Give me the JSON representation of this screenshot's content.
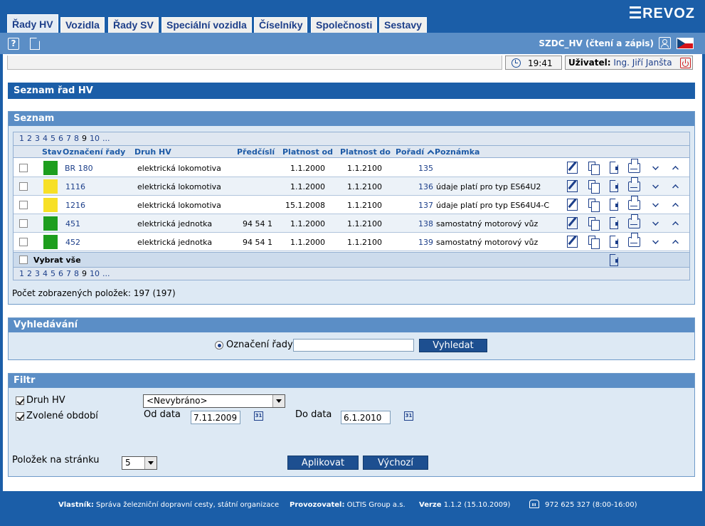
{
  "app": {
    "logo": "REVOZ",
    "role": "SZDC_HV (čtení a zápis)"
  },
  "tabs": [
    {
      "label": "Řady HV",
      "active": true
    },
    {
      "label": "Vozidla",
      "active": false
    },
    {
      "label": "Řady SV",
      "active": false
    },
    {
      "label": "Speciální vozidla",
      "active": false
    },
    {
      "label": "Číselníky",
      "active": false
    },
    {
      "label": "Společnosti",
      "active": false
    },
    {
      "label": "Sestavy",
      "active": false
    }
  ],
  "status": {
    "time": "19:41",
    "user_label": "Uživatel:",
    "user_name": "Ing. Jiří Janšta"
  },
  "page_title": "Seznam řad HV",
  "list": {
    "title": "Seznam",
    "pages": [
      "1",
      "2",
      "3",
      "4",
      "5",
      "6",
      "7",
      "8",
      "9",
      "10",
      "..."
    ],
    "current_page": "9",
    "columns": {
      "stav": "Stav",
      "oznaceni": "Označení řady",
      "druh": "Druh HV",
      "predcisli": "Předčíslí",
      "platnost_od": "Platnost od",
      "platnost_do": "Platnost do",
      "poradi": "Pořadí",
      "poznamka": "Poznámka"
    },
    "rows": [
      {
        "color": "#1e9e1e",
        "oznaceni": "BR 180",
        "druh": "elektrická lokomotiva",
        "predcisli": "",
        "od": "1.1.2000",
        "do": "1.1.2100",
        "poradi": "135",
        "poznamka": ""
      },
      {
        "color": "#f7e026",
        "oznaceni": "1116",
        "druh": "elektrická lokomotiva",
        "predcisli": "",
        "od": "1.1.2000",
        "do": "1.1.2100",
        "poradi": "136",
        "poznamka": "údaje platí pro typ ES64U2"
      },
      {
        "color": "#f7e026",
        "oznaceni": "1216",
        "druh": "elektrická lokomotiva",
        "predcisli": "",
        "od": "15.1.2008",
        "do": "1.1.2100",
        "poradi": "137",
        "poznamka": "údaje platí pro typ ES64U4-C"
      },
      {
        "color": "#1e9e1e",
        "oznaceni": "451",
        "druh": "elektrická jednotka",
        "predcisli": "94 54 1",
        "od": "1.1.2000",
        "do": "1.1.2100",
        "poradi": "138",
        "poznamka": "samostatný motorový vůz"
      },
      {
        "color": "#1e9e1e",
        "oznaceni": "452",
        "druh": "elektrická jednotka",
        "predcisli": "94 54 1",
        "od": "1.1.2000",
        "do": "1.1.2100",
        "poradi": "139",
        "poznamka": "samostatný motorový vůz"
      }
    ],
    "select_all": "Vybrat vše",
    "count_text": "Počet zobrazených položek: 197 (197)"
  },
  "search": {
    "title": "Vyhledávání",
    "radio_label": "Označení řady",
    "value": "",
    "button": "Vyhledat"
  },
  "filter": {
    "title": "Filtr",
    "druh_label": "Druh HV",
    "druh_value": "<Nevybráno>",
    "obdobi_label": "Zvolené období",
    "od_label": "Od data",
    "od_value": "7.11.2009",
    "do_label": "Do data",
    "do_value": "6.1.2010",
    "per_page_label": "Položek na stránku",
    "per_page_value": "5",
    "apply_button": "Aplikovat",
    "default_button": "Výchozí",
    "calendar_glyph": "31"
  },
  "footer": {
    "owner_label": "Vlastník:",
    "owner": "Správa železniční dopravní cesty, státní organizace",
    "operator_label": "Provozovatel:",
    "operator": "OLTIS Group a.s.",
    "version_label": "Verze",
    "version": "1.1.2 (15.10.2009)",
    "phone": "972 625 327 (8:00-16:00)"
  }
}
